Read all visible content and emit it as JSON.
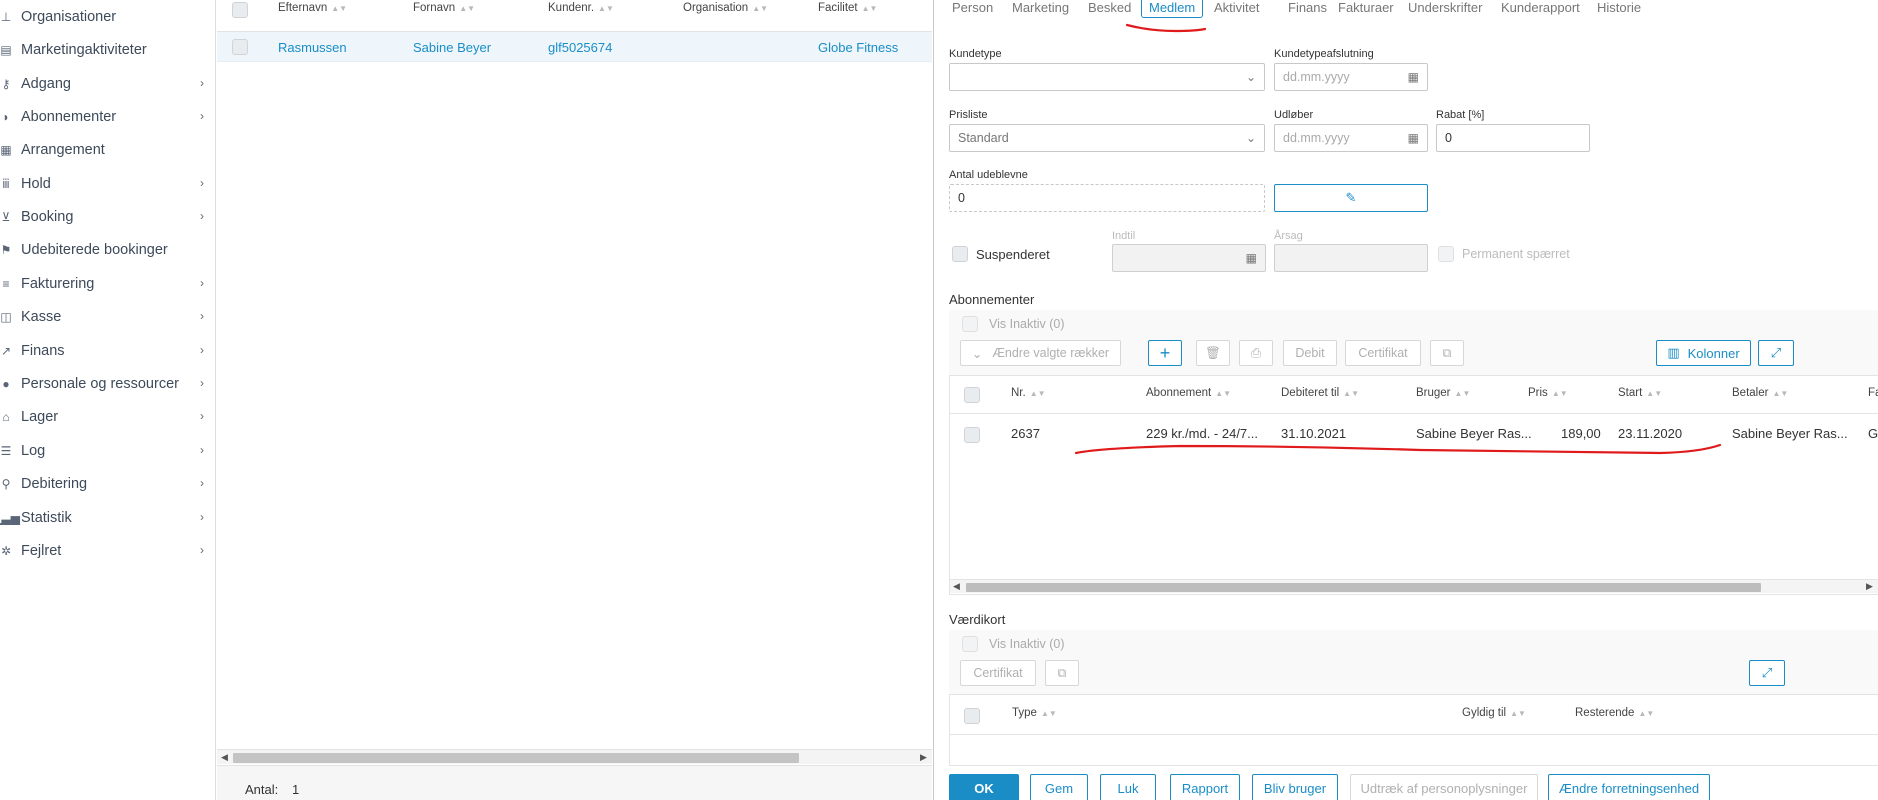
{
  "sidebar": {
    "items": [
      {
        "label": "Organisationer",
        "icon": "org-chart-icon",
        "expandable": false
      },
      {
        "label": "Marketingaktiviteter",
        "icon": "marketing-icon",
        "expandable": false
      },
      {
        "label": "Adgang",
        "icon": "key-icon",
        "expandable": true
      },
      {
        "label": "Abonnementer",
        "icon": "shield-icon",
        "expandable": true
      },
      {
        "label": "Arrangement",
        "icon": "calendar-icon",
        "expandable": false
      },
      {
        "label": "Hold",
        "icon": "group-icon",
        "expandable": true
      },
      {
        "label": "Booking",
        "icon": "cart-icon",
        "expandable": true
      },
      {
        "label": "Udebiterede bookinger",
        "icon": "flag-icon",
        "expandable": false
      },
      {
        "label": "Fakturering",
        "icon": "invoice-icon",
        "expandable": true
      },
      {
        "label": "Kasse",
        "icon": "cash-register-icon",
        "expandable": true
      },
      {
        "label": "Finans",
        "icon": "trend-icon",
        "expandable": true
      },
      {
        "label": "Personale og ressourcer",
        "icon": "person-icon",
        "expandable": true
      },
      {
        "label": "Lager",
        "icon": "warehouse-icon",
        "expandable": true
      },
      {
        "label": "Log",
        "icon": "list-icon",
        "expandable": true
      },
      {
        "label": "Debitering",
        "icon": "billing-icon",
        "expandable": true
      },
      {
        "label": "Statistik",
        "icon": "bar-chart-icon",
        "expandable": true
      },
      {
        "label": "Fejlret",
        "icon": "bug-icon",
        "expandable": true
      }
    ]
  },
  "list": {
    "columns": [
      "Efternavn",
      "Fornavn",
      "Kundenr.",
      "Organisation",
      "Facilitet"
    ],
    "rows": [
      {
        "efternavn": "Rasmussen",
        "fornavn": "Sabine Beyer",
        "kundenr": "glf5025674",
        "organisation": "",
        "facilitet": "Globe Fitness"
      }
    ],
    "footer_label": "Antal:",
    "footer_count": "1"
  },
  "detail": {
    "tabs": [
      "Person",
      "Marketing",
      "Besked",
      "Medlem",
      "Aktivitet",
      "Finans",
      "Fakturaer",
      "Underskrifter",
      "Kunderapport",
      "Historie"
    ],
    "active_tab": "Medlem",
    "form": {
      "kundetype_label": "Kundetype",
      "kundetype_value": "",
      "kundetypeafslutning_label": "Kundetypeafslutning",
      "date_placeholder": "dd.mm.yyyy",
      "prisliste_label": "Prisliste",
      "prisliste_value": "Standard",
      "udloeber_label": "Udløber",
      "rabat_label": "Rabat [%]",
      "rabat_value": "0",
      "antal_udeblevne_label": "Antal udeblevne",
      "antal_udeblevne_value": "0",
      "suspenderet_label": "Suspenderet",
      "indtil_label": "Indtil",
      "aarsag_label": "Årsag",
      "permanent_spaerret_label": "Permanent spærret"
    },
    "abonnementer": {
      "title": "Abonnementer",
      "vis_inaktiv": "Vis Inaktiv (0)",
      "aendre_label": "Ændre valgte rækker",
      "debit_label": "Debit",
      "certifikat_label": "Certifikat",
      "kolonner_label": "Kolonner",
      "columns": [
        "Nr.",
        "Abonnement",
        "Debiteret til",
        "Bruger",
        "Pris",
        "Start",
        "Betaler",
        "Fa"
      ],
      "rows": [
        {
          "nr": "2637",
          "abonnement": "229 kr./md. - 24/7...",
          "debiteret_til": "31.10.2021",
          "bruger": "Sabine Beyer Ras...",
          "pris": "189,00",
          "start": "23.11.2020",
          "betaler": "Sabine Beyer Ras...",
          "fa": "G"
        }
      ]
    },
    "vaerdikort": {
      "title": "Værdikort",
      "vis_inaktiv": "Vis Inaktiv (0)",
      "certifikat_label": "Certifikat",
      "columns": [
        "Type",
        "Gyldig til",
        "Resterende"
      ]
    },
    "buttons": {
      "ok": "OK",
      "gem": "Gem",
      "luk": "Luk",
      "rapport": "Rapport",
      "bliv_bruger": "Bliv bruger",
      "udtraek": "Udtræk af personoplysninger",
      "aendre_forretningsenhed": "Ændre forretningsenhed"
    }
  },
  "colors": {
    "accent": "#1a8dc7",
    "annotation": "#e0191a",
    "selected_row": "#eef6fb"
  }
}
